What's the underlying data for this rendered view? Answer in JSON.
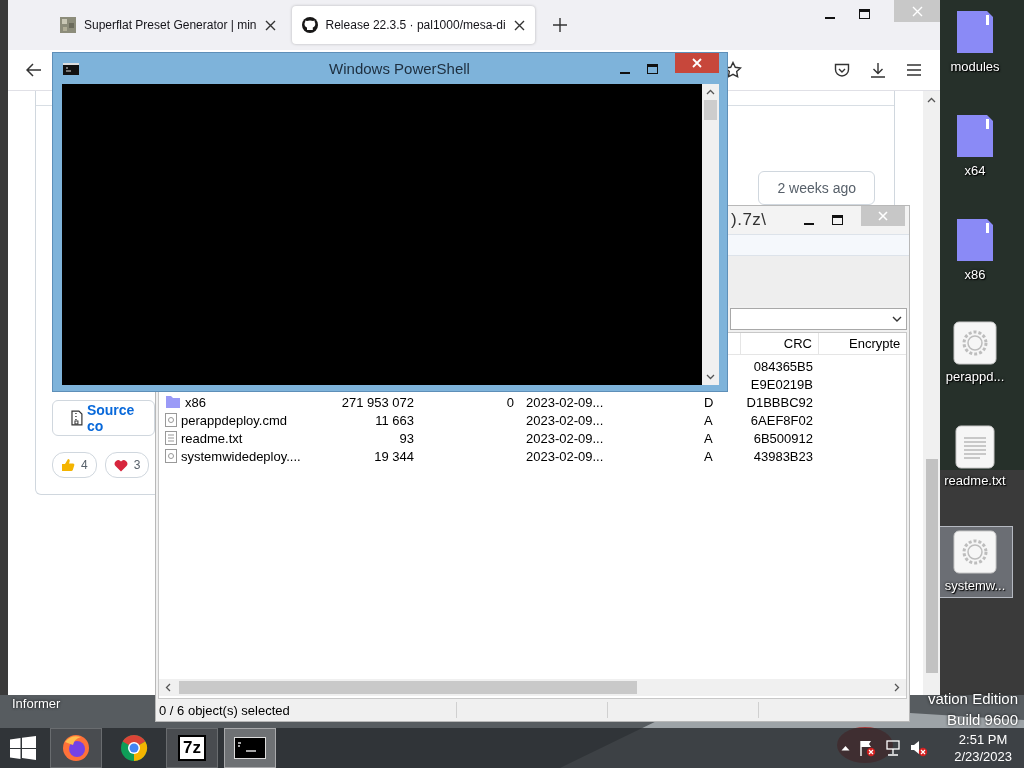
{
  "desktop": {
    "icons": [
      {
        "label": "modules",
        "kind": "folder",
        "selected": false
      },
      {
        "label": "x64",
        "kind": "folder",
        "selected": false
      },
      {
        "label": "x86",
        "kind": "folder",
        "selected": false
      },
      {
        "label": "perappd...",
        "kind": "gear",
        "selected": false
      },
      {
        "label": "readme.txt",
        "kind": "document",
        "selected": false
      },
      {
        "label": "systemw...",
        "kind": "gear",
        "selected": true
      }
    ],
    "covered_icon_label": "Informer",
    "edition_lines": [
      "vation Edition",
      "Build 9600"
    ]
  },
  "browser": {
    "tabs": [
      {
        "title": "Superflat Preset Generator | min",
        "kind": "tile",
        "selected": false
      },
      {
        "title": "Release 22.3.5 · pal1000/mesa-di",
        "kind": "github",
        "selected": true
      }
    ],
    "release_time": "2 weeks ago",
    "source_link": "Source co",
    "reactions": [
      {
        "kind": "thumbs_up",
        "count": "4"
      },
      {
        "kind": "heart",
        "count": "3"
      }
    ]
  },
  "archive": {
    "title": ").7z\\",
    "columns": [
      {
        "label": "CRC"
      },
      {
        "label": "Encrypte"
      }
    ],
    "rows": [
      {
        "crc": "084365B5"
      },
      {
        "crc": "E9E0219B"
      },
      {
        "kind": "folder",
        "name": "x86",
        "size": "271 953 072",
        "packed_size": "0",
        "modified": "2023-02-09...",
        "attributes": "D",
        "crc": "D1BBBC92"
      },
      {
        "kind": "cmd",
        "name": "perappdeploy.cmd",
        "size": "11 663",
        "modified": "2023-02-09...",
        "attributes": "A",
        "crc": "6AEF8F02"
      },
      {
        "kind": "txt",
        "name": "readme.txt",
        "size": "93",
        "modified": "2023-02-09...",
        "attributes": "A",
        "crc": "6B500912"
      },
      {
        "kind": "cmd",
        "name": "systemwidedeploy....",
        "size": "19 344",
        "modified": "2023-02-09...",
        "attributes": "A",
        "crc": "43983B23"
      }
    ],
    "status_bar": "0 / 6 object(s) selected"
  },
  "powershell": {
    "title": "Windows PowerShell"
  },
  "taskbar": {
    "apps": [
      {
        "kind": "firefox",
        "running": true,
        "selected": false
      },
      {
        "kind": "chrome",
        "running": false,
        "selected": false
      },
      {
        "kind": "sevenzip",
        "label": "7z",
        "running": true,
        "selected": false
      },
      {
        "kind": "console",
        "running": true,
        "selected": true
      }
    ],
    "clock": {
      "time": "2:51 PM",
      "date": "2/23/2023"
    }
  }
}
